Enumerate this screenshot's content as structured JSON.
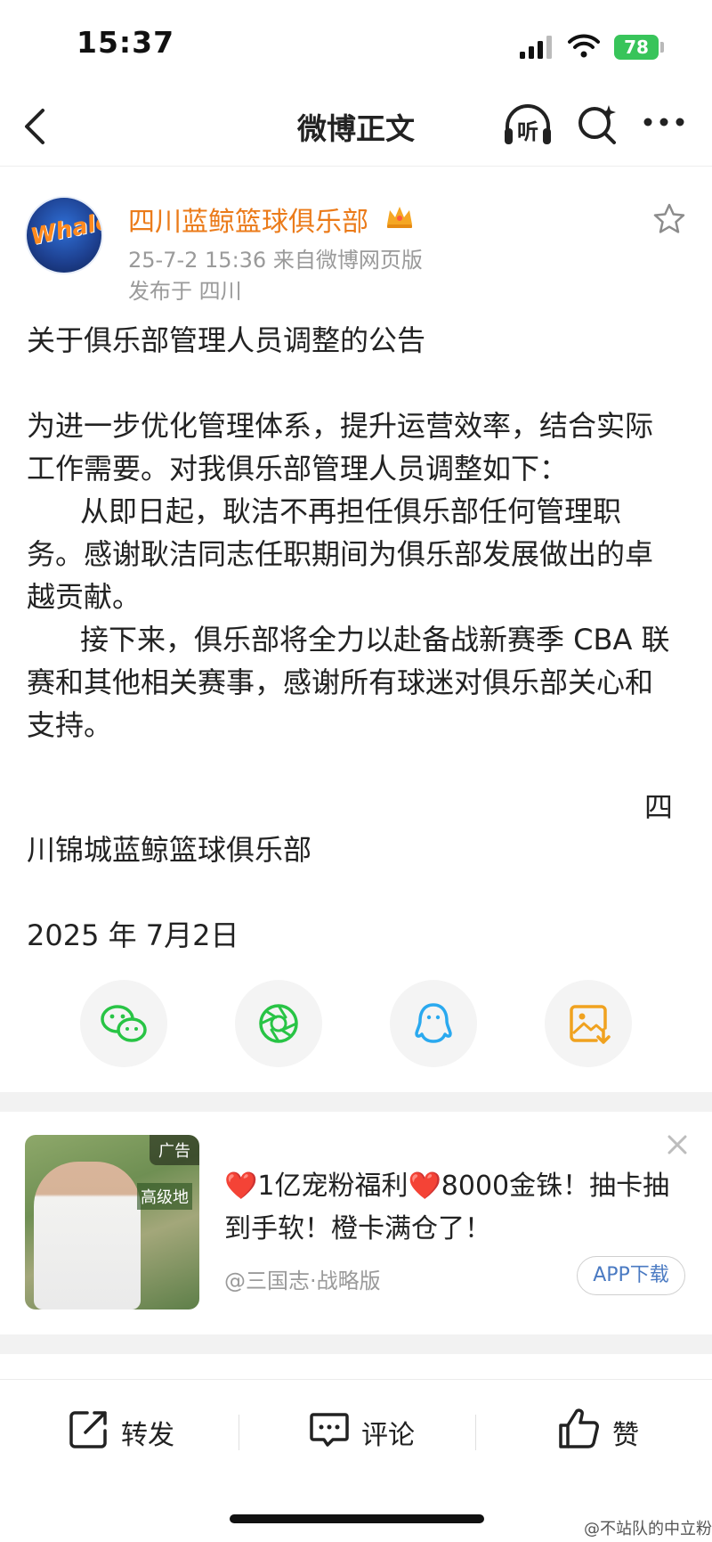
{
  "status_bar": {
    "time": "15:37",
    "battery": "78"
  },
  "nav": {
    "title": "微博正文",
    "back_icon": "chevron-left-icon",
    "listen_label": "听",
    "search_icon": "search-sparkle-icon",
    "more_icon": "more-horizontal-icon"
  },
  "post": {
    "user_name": "四川蓝鲸篮球俱乐部",
    "avatar_text": "Whale",
    "meta_time_source": "25-7-2 15:36  来自微博网页版",
    "meta_location": "发布于 四川",
    "paragraphs": {
      "title": "关于俱乐部管理人员调整的公告",
      "p1_line1": "为进一步优化管理体系，提升运营效率，结合实际",
      "p1_line2": "工作需要。对我俱乐部管理人员调整如下：",
      "p2_line1": "从即日起，耿洁不再担任俱乐部任何管理职",
      "p2_line2": "务。感谢耿洁同志任职期间为俱乐部发展做出的卓",
      "p2_line3": "越贡献。",
      "p3_line1": "接下来，俱乐部将全力以赴备战新赛季 CBA 联",
      "p3_line2": "赛和其他相关赛事，感谢所有球迷对俱乐部关心和",
      "p3_line3": "支持。",
      "sign_char": "四",
      "sign_rest": "川锦城蓝鲸篮球俱乐部",
      "date": "2025 年 7月2日"
    }
  },
  "share": {
    "wechat_icon": "wechat-icon",
    "moments_icon": "moments-shutter-icon",
    "qq_icon": "qq-penguin-icon",
    "save_image_icon": "save-image-icon"
  },
  "ad": {
    "tag": "广告",
    "img_label": "高级地",
    "line1": "❤️1亿宠粉福利❤️8000金铢！抽卡抽",
    "line2": "到手软！橙卡满仓了！",
    "source": "@三国志·战略版",
    "app_button": "APP下载"
  },
  "toolbar": {
    "repost_label": "转发",
    "comment_label": "评论",
    "like_label": "赞"
  },
  "watermark": "@不站队的中立粉",
  "colors": {
    "name_orange": "#eb7b1a",
    "battery_green": "#38c45a",
    "wechat_green": "#28c445",
    "qq_blue": "#2aa9ef",
    "save_orange": "#f0a21f"
  }
}
